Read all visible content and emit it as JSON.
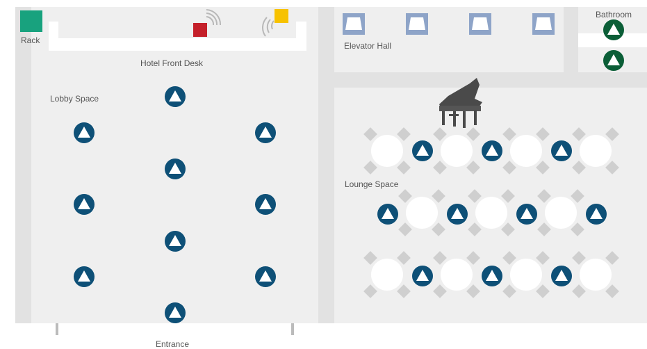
{
  "labels": {
    "rack": "Rack",
    "front_desk": "Hotel Front Desk",
    "lobby": "Lobby Space",
    "elevator_hall": "Elevator Hall",
    "bathroom": "Bathroom",
    "lounge": "Lounge Space",
    "entrance": "Entrance"
  },
  "icons": {
    "access_point": "access-point-icon",
    "bathroom_access_point": "access-point-icon",
    "elevator": "elevator-icon",
    "piano": "grand-piano-icon",
    "table": "round-table-icon",
    "rack": "rack-icon",
    "red_device": "router-icon",
    "yellow_device": "router-icon"
  },
  "colors": {
    "floor": "#efefef",
    "wall": "#e2e2e2",
    "access_point": "#0e5077",
    "bathroom_access_point": "#0b5e37",
    "rack": "#18a27e",
    "red_device": "#c4202a",
    "yellow_device": "#f7c200",
    "elevator": "#8ea4c8",
    "table_chair": "#cfcfcf"
  }
}
